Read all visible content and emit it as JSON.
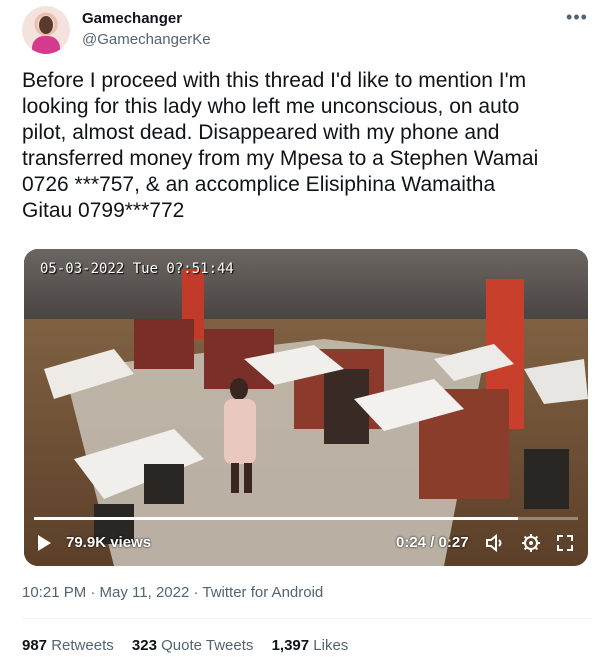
{
  "author": {
    "name": "Gamechanger",
    "handle": "@GamechangerKe"
  },
  "tweet": {
    "text": "Before I proceed with this thread I'd like to mention I'm\nlooking for this lady who left me unconscious, on auto\npilot, almost dead. Disappeared with my phone and\ntransferred money from my Mpesa to a Stephen Wamai\n0726 ***757, & an accomplice Elisiphina Wamaitha\nGitau 0799***772"
  },
  "media": {
    "cctv_timestamp": "05-03-2022 Tue 0?:51:44",
    "views_label": "79.9K views",
    "time_label": "0:24 / 0:27",
    "progress": 0.89
  },
  "meta": {
    "timestamp": "10:21 PM · May 11, 2022 · Twitter for Android"
  },
  "stats": {
    "retweets_count": "987",
    "retweets_label": "Retweets",
    "quotes_count": "323",
    "quotes_label": "Quote Tweets",
    "likes_count": "1,397",
    "likes_label": "Likes"
  },
  "icons": {
    "more": "more-horizontal-icon",
    "play": "play-icon",
    "volume": "volume-icon",
    "settings": "settings-gear-icon",
    "fullscreen": "fullscreen-icon"
  },
  "colors": {
    "text": "#0f1419",
    "secondary": "#536471",
    "divider": "#eff3f4"
  }
}
